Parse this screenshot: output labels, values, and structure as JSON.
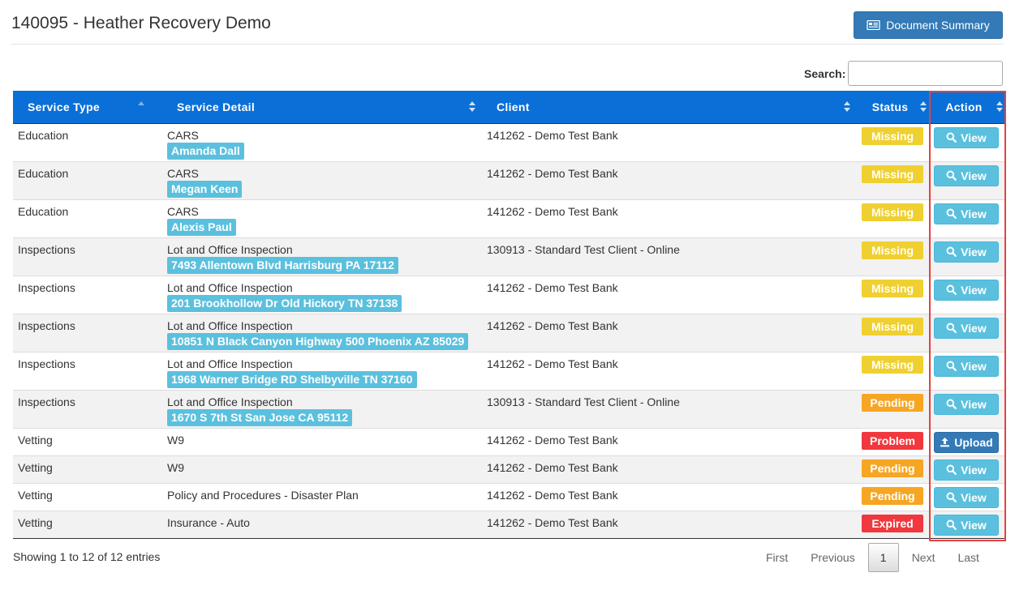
{
  "page": {
    "title": "140095 - Heather Recovery Demo"
  },
  "header": {
    "doc_summary_label": "Document Summary"
  },
  "search": {
    "label": "Search:",
    "value": "",
    "placeholder": ""
  },
  "table": {
    "columns": [
      "Service Type",
      "Service Detail",
      "Client",
      "Status",
      "Action"
    ],
    "rows": [
      {
        "type": "Education",
        "detail": "CARS",
        "tag": "Amanda Dall",
        "client": "141262 - Demo Test Bank",
        "status": "Missing",
        "action": "View"
      },
      {
        "type": "Education",
        "detail": "CARS",
        "tag": "Megan Keen",
        "client": "141262 - Demo Test Bank",
        "status": "Missing",
        "action": "View"
      },
      {
        "type": "Education",
        "detail": "CARS",
        "tag": "Alexis Paul",
        "client": "141262 - Demo Test Bank",
        "status": "Missing",
        "action": "View"
      },
      {
        "type": "Inspections",
        "detail": "Lot and Office Inspection",
        "tag": "7493 Allentown Blvd Harrisburg PA 17112",
        "client": "130913 - Standard Test Client - Online",
        "status": "Missing",
        "action": "View"
      },
      {
        "type": "Inspections",
        "detail": "Lot and Office Inspection",
        "tag": "201 Brookhollow Dr Old Hickory TN 37138",
        "client": "141262 - Demo Test Bank",
        "status": "Missing",
        "action": "View"
      },
      {
        "type": "Inspections",
        "detail": "Lot and Office Inspection",
        "tag": "10851 N Black Canyon Highway 500 Phoenix AZ 85029",
        "client": "141262 - Demo Test Bank",
        "status": "Missing",
        "action": "View"
      },
      {
        "type": "Inspections",
        "detail": "Lot and Office Inspection",
        "tag": "1968 Warner Bridge RD Shelbyville TN 37160",
        "client": "141262 - Demo Test Bank",
        "status": "Missing",
        "action": "View"
      },
      {
        "type": "Inspections",
        "detail": "Lot and Office Inspection",
        "tag": "1670 S 7th St San Jose CA 95112",
        "client": "130913 - Standard Test Client - Online",
        "status": "Pending",
        "action": "View"
      },
      {
        "type": "Vetting",
        "detail": "W9",
        "tag": "",
        "client": "141262 - Demo Test Bank",
        "status": "Problem",
        "action": "Upload"
      },
      {
        "type": "Vetting",
        "detail": "W9",
        "tag": "",
        "client": "141262 - Demo Test Bank",
        "status": "Pending",
        "action": "View"
      },
      {
        "type": "Vetting",
        "detail": "Policy and Procedures - Disaster Plan",
        "tag": "",
        "client": "141262 - Demo Test Bank",
        "status": "Pending",
        "action": "View"
      },
      {
        "type": "Vetting",
        "detail": "Insurance - Auto",
        "tag": "",
        "client": "141262 - Demo Test Bank",
        "status": "Expired",
        "action": "View"
      }
    ]
  },
  "footer": {
    "info": "Showing 1 to 12 of 12 entries"
  },
  "pagination": {
    "first": "First",
    "previous": "Previous",
    "current": "1",
    "next": "Next",
    "last": "Last"
  },
  "colors": {
    "header_blue": "#0a6fd6",
    "missing": "#f0d030",
    "pending": "#f6a623",
    "problem": "#f0383e",
    "view_button": "#5bc0de",
    "upload_button": "#337ab7",
    "highlight": "#e84040"
  }
}
